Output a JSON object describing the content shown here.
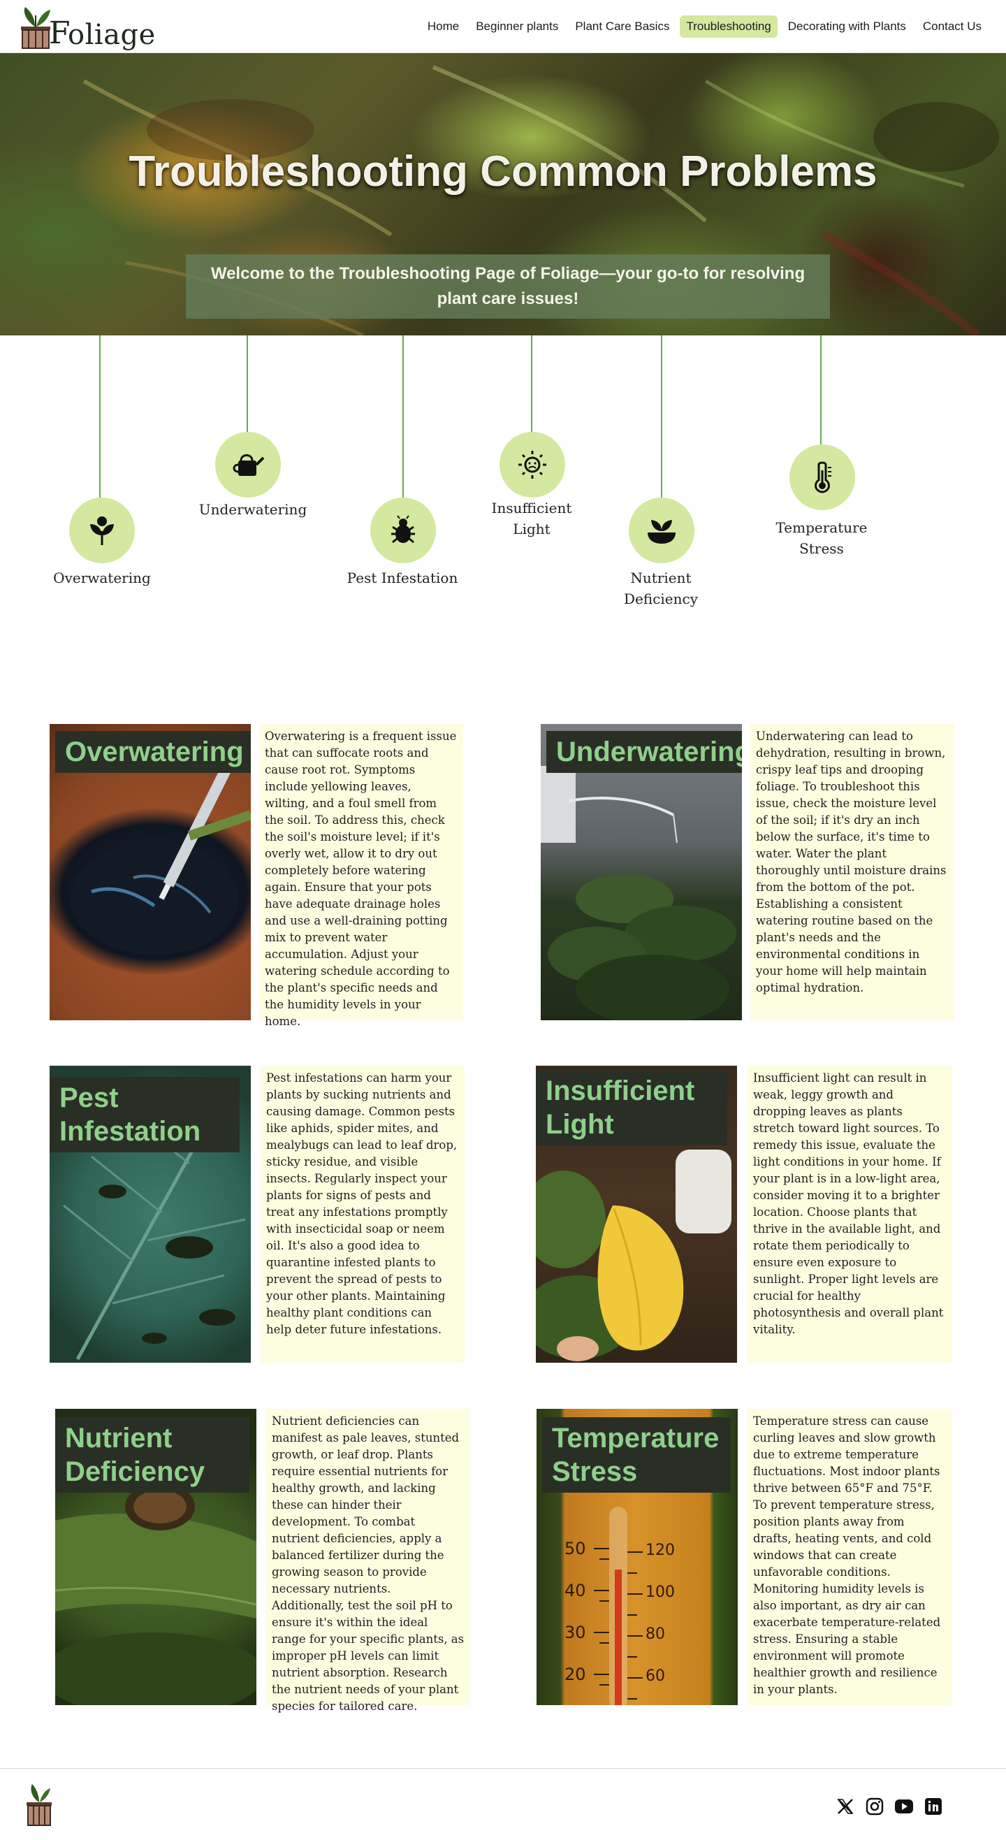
{
  "brand": {
    "name": "oliage",
    "logo_letter": "F"
  },
  "nav": {
    "items": [
      {
        "label": "Home",
        "active": false
      },
      {
        "label": "Beginner plants",
        "active": false
      },
      {
        "label": "Plant Care Basics",
        "active": false
      },
      {
        "label": "Troubleshooting",
        "active": true
      },
      {
        "label": "Decorating with Plants",
        "active": false
      },
      {
        "label": "Contact Us",
        "active": false
      }
    ]
  },
  "hero": {
    "title": "Troubleshooting Common Problems",
    "subtitle": "Welcome to the Troubleshooting Page of Foliage—your go-to for resolving plant care issues!"
  },
  "problems": [
    {
      "label": "Overwatering",
      "icon": "sprout-icon"
    },
    {
      "label": "Underwatering",
      "icon": "watering-can-icon"
    },
    {
      "label": "Pest Infestation",
      "icon": "bug-icon"
    },
    {
      "label": "Insufficient Light",
      "icon": "sun-icon"
    },
    {
      "label": "Nutrient Deficiency",
      "icon": "plant-bowl-icon"
    },
    {
      "label": "Temperature Stress",
      "icon": "thermometer-icon"
    }
  ],
  "cards": [
    {
      "title": "Overwatering",
      "text": "Overwatering is a frequent issue that can suffocate roots and cause root rot. Symptoms include yellowing leaves, wilting, and a foul smell from the soil. To address this, check the soil's moisture level; if it's overly wet, allow it to dry out completely before watering again. Ensure that your pots have adequate drainage holes and use a well-draining potting mix to prevent water accumulation. Adjust your watering schedule according to the plant's specific needs and the humidity levels in your home."
    },
    {
      "title": "Underwatering",
      "text": "Underwatering can lead to dehydration, resulting in brown, crispy leaf tips and drooping foliage. To troubleshoot this issue, check the moisture level of the soil; if it's dry an inch below the surface, it's time to water. Water the plant thoroughly until moisture drains from the bottom of the pot. Establishing a consistent watering routine based on the plant's needs and the environmental conditions in your home will help maintain optimal hydration."
    },
    {
      "title": "Pest Infestation",
      "text": "Pest infestations can harm your plants by sucking nutrients and causing damage. Common pests like aphids, spider mites, and mealybugs can lead to leaf drop, sticky residue, and visible insects. Regularly inspect your plants for signs of pests and treat any infestations promptly with insecticidal soap or neem oil. It's also a good idea to quarantine infested plants to prevent the spread of pests to your other plants. Maintaining healthy plant conditions can help deter future infestations."
    },
    {
      "title": "Insufficient Light",
      "text": "Insufficient light can result in weak, leggy growth and dropping leaves as plants stretch toward light sources. To remedy this issue, evaluate the light conditions in your home. If your plant is in a low-light area, consider moving it to a brighter location. Choose plants that thrive in the available light, and rotate them periodically to ensure even exposure to sunlight. Proper light levels are crucial for healthy photosynthesis and overall plant vitality."
    },
    {
      "title": "Nutrient Deficiency",
      "text": "Nutrient deficiencies can manifest as pale leaves, stunted growth, or leaf drop. Plants require essential nutrients for healthy growth, and lacking these can hinder their development. To combat nutrient deficiencies, apply a balanced fertilizer during the growing season to provide necessary nutrients. Additionally, test the soil pH to ensure it's within the ideal range for your specific plants, as improper pH levels can limit nutrient absorption. Research the nutrient needs of your plant species for tailored care."
    },
    {
      "title": "Temperature Stress",
      "text": "Temperature stress can cause curling leaves and slow growth due to extreme temperature fluctuations. Most indoor plants thrive between 65°F and 75°F. To prevent temperature stress, position plants away from drafts, heating vents, and cold windows that can create unfavorable conditions. Monitoring humidity levels is also important, as dry air can exacerbate temperature-related stress. Ensuring a stable environment will promote healthier growth and resilience in your plants."
    }
  ],
  "thermometer_scale": {
    "fahrenheit": [
      "120",
      "100",
      "80",
      "60"
    ],
    "celsius": [
      "50",
      "40",
      "30",
      "20"
    ]
  },
  "footer": {
    "socials": [
      "x-icon",
      "instagram-icon",
      "youtube-icon",
      "linkedin-icon"
    ]
  },
  "colors": {
    "accent": "#d4e8a0",
    "card_bg": "#fdfde0",
    "title_text": "#8fd08a",
    "title_bg": "#2a2f26",
    "line": "#6aa84f"
  }
}
